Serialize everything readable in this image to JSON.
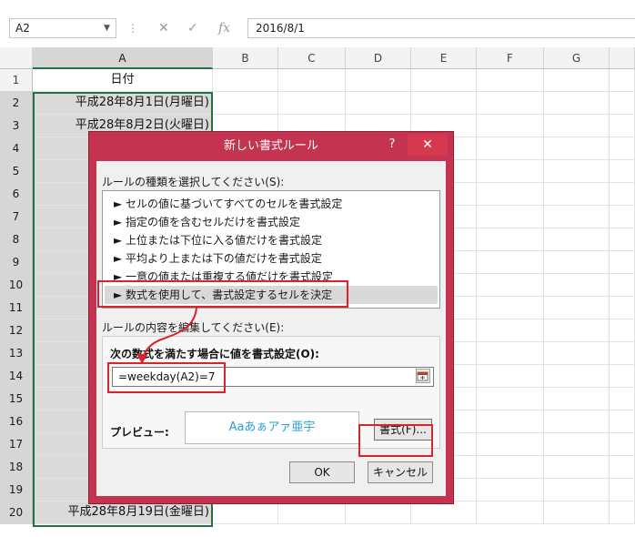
{
  "formula_bar": {
    "name_box": "A2",
    "formula": "2016/8/1",
    "fx_label": "fx"
  },
  "sheet": {
    "columns": [
      "A",
      "B",
      "C",
      "D",
      "E",
      "F",
      "G"
    ],
    "rows": [
      {
        "n": "1",
        "a": "日付",
        "sel": false,
        "red": false
      },
      {
        "n": "2",
        "a": "平成28年8月1日(月曜日)",
        "sel": true,
        "red": false
      },
      {
        "n": "3",
        "a": "平成28年8月2日(火曜日)",
        "sel": true,
        "red": false
      },
      {
        "n": "4",
        "a": "平成2",
        "sel": true,
        "red": false
      },
      {
        "n": "5",
        "a": "平成2",
        "sel": true,
        "red": false
      },
      {
        "n": "6",
        "a": "平成2",
        "sel": true,
        "red": false
      },
      {
        "n": "7",
        "a": "平成2",
        "sel": true,
        "red": false
      },
      {
        "n": "8",
        "a": "平成2",
        "sel": true,
        "red": true
      },
      {
        "n": "9",
        "a": "平成2",
        "sel": true,
        "red": false
      },
      {
        "n": "10",
        "a": "平成2",
        "sel": true,
        "red": false
      },
      {
        "n": "11",
        "a": "平成28",
        "sel": true,
        "red": false
      },
      {
        "n": "12",
        "a": "平成28",
        "sel": true,
        "red": false
      },
      {
        "n": "13",
        "a": "平成28",
        "sel": true,
        "red": false
      },
      {
        "n": "14",
        "a": "平成28",
        "sel": true,
        "red": false
      },
      {
        "n": "15",
        "a": "平成28",
        "sel": true,
        "red": true
      },
      {
        "n": "16",
        "a": "平成28",
        "sel": true,
        "red": false
      },
      {
        "n": "17",
        "a": "平成28",
        "sel": true,
        "red": false
      },
      {
        "n": "18",
        "a": "平成28",
        "sel": true,
        "red": false
      },
      {
        "n": "19",
        "a": "平成28",
        "sel": true,
        "red": false
      },
      {
        "n": "20",
        "a": "平成28年8月19日(金曜日)",
        "sel": true,
        "red": false
      }
    ]
  },
  "dialog": {
    "title": "新しい書式ルール",
    "help": "?",
    "close": "✕",
    "rule_type_label": "ルールの種類を選択してください(S):",
    "rule_types": [
      "► セルの値に基づいてすべてのセルを書式設定",
      "► 指定の値を含むセルだけを書式設定",
      "► 上位または下位に入る値だけを書式設定",
      "► 平均より上または下の値だけを書式設定",
      "► 一意の値または重複する値だけを書式設定",
      "► 数式を使用して、書式設定するセルを決定"
    ],
    "selected_rule_index": 5,
    "description_label": "ルールの内容を編集してください(E):",
    "condition_label": "次の数式を満たす場合に値を書式設定(O):",
    "formula_value": "=weekday(A2)=7",
    "preview_label": "プレビュー:",
    "preview_text": "Aaあぁアァ亜宇",
    "format_button": "書式(F)...",
    "ok_button": "OK",
    "cancel_button": "キャンセル"
  },
  "colors": {
    "dialog_frame": "#c4334f",
    "selection_green": "#217346",
    "annotation_red": "#d9232d",
    "weekend_text": "#e0241b",
    "preview_text": "#2a9fd6"
  }
}
